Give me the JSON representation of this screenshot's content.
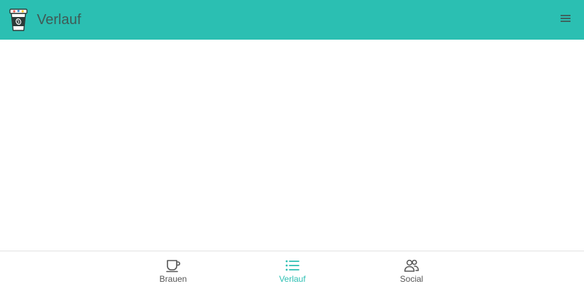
{
  "header": {
    "title": "Verlauf",
    "background_color": "#2bbfb2",
    "title_color": "#3f5a56",
    "logo_icon": "coffee-cup-logo-icon",
    "menu_icon": "hamburger-menu-icon"
  },
  "bottom_nav": {
    "active_color": "#2bbfb2",
    "inactive_color": "#555555",
    "items": [
      {
        "label": "Brauen",
        "icon": "coffee-cup-icon",
        "active": false
      },
      {
        "label": "Verlauf",
        "icon": "list-icon",
        "active": true
      },
      {
        "label": "Social",
        "icon": "people-icon",
        "active": false
      }
    ]
  }
}
